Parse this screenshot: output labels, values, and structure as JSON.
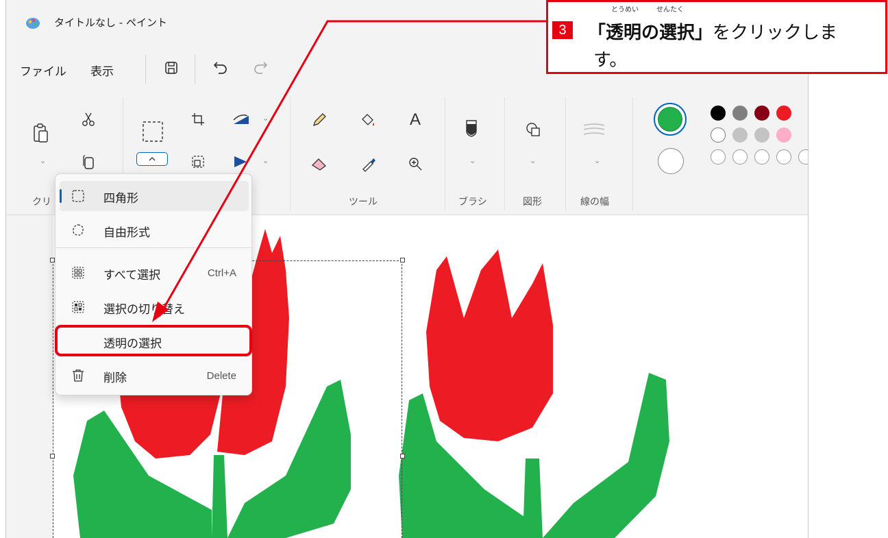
{
  "window": {
    "title": "タイトルなし - ペイント"
  },
  "menubar": {
    "file": "ファイル",
    "view": "表示"
  },
  "ribbon": {
    "groups": {
      "clipboard": "クリ",
      "tools": "ツール",
      "brush": "ブラシ",
      "shapes": "図形",
      "size": "線の幅"
    },
    "text_tool": "A"
  },
  "colors": {
    "primary": "#22b14c",
    "secondary": "#ffffff",
    "palette_row1": [
      "#000000",
      "#7f7f7f",
      "#880015",
      "#ed1c24"
    ],
    "palette_row2": [
      "#ffffff",
      "#c3c3c3",
      "#c3c3c3",
      "#ffaec9"
    ],
    "accent": "#e60012"
  },
  "select_menu": {
    "items": [
      {
        "label": "四角形",
        "shortcut": "",
        "icon": "rectangle-select-icon"
      },
      {
        "label": "自由形式",
        "shortcut": "",
        "icon": "freeform-select-icon"
      },
      {
        "label": "すべて選択",
        "shortcut": "Ctrl+A",
        "icon": "select-all-icon"
      },
      {
        "label": "選択の切り替え",
        "shortcut": "",
        "icon": "invert-selection-icon"
      },
      {
        "label": "透明の選択",
        "shortcut": "",
        "icon": ""
      },
      {
        "label": "削除",
        "shortcut": "Delete",
        "icon": "trash-icon"
      }
    ]
  },
  "callout": {
    "step": "3",
    "open_bracket": "「",
    "emphasis": "透明の選択",
    "close_bracket": "」",
    "rest": "をクリックしま",
    "line2": "す。",
    "ruby1": "とうめい",
    "ruby2": "せんたく"
  }
}
